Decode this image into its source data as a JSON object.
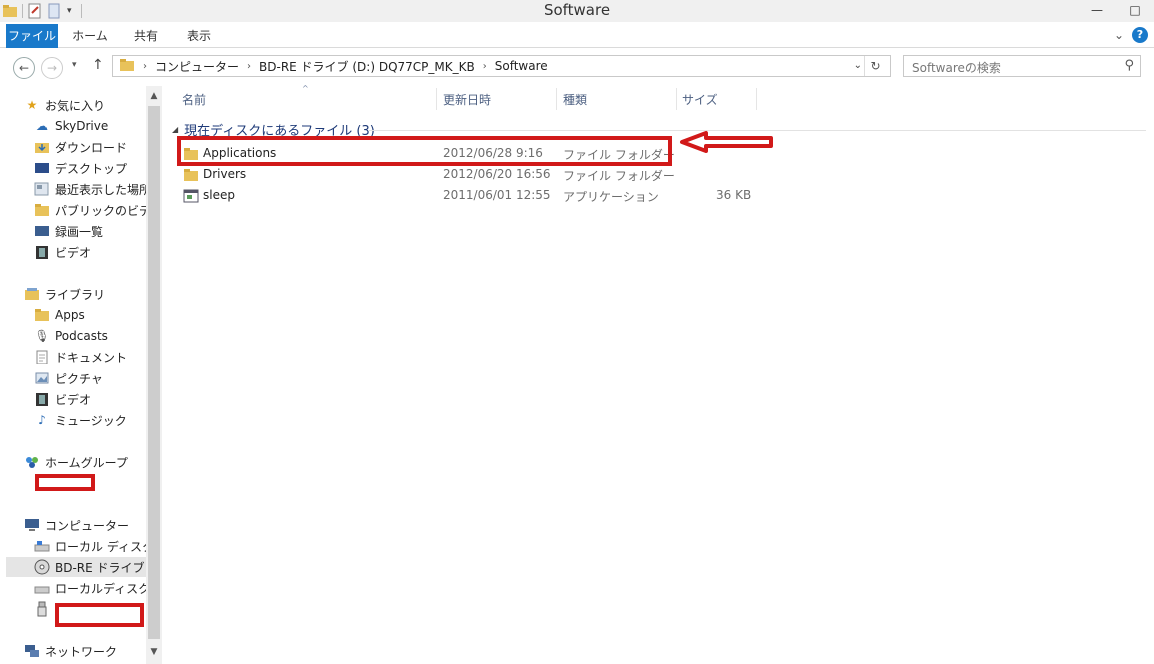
{
  "window": {
    "title": "Software",
    "minimize": "—",
    "maximize": "□"
  },
  "ribbon": {
    "tabs": [
      "ファイル",
      "ホーム",
      "共有",
      "表示"
    ]
  },
  "address": {
    "crumbs": [
      "コンピューター",
      "BD-RE ドライブ (D:) DQ77CP_MK_KB",
      "Software"
    ]
  },
  "search": {
    "placeholder": "Softwareの検索"
  },
  "navpane": {
    "favorites": {
      "label": "お気に入り",
      "items": [
        "SkyDrive",
        "ダウンロード",
        "デスクトップ",
        "最近表示した場所",
        "パブリックのビデオ",
        "録画一覧",
        "ビデオ"
      ]
    },
    "libraries": {
      "label": "ライブラリ",
      "items": [
        "Apps",
        "Podcasts",
        "ドキュメント",
        "ピクチャ",
        "ビデオ",
        "ミュージック"
      ]
    },
    "homegroup": {
      "label": "ホームグループ"
    },
    "computer": {
      "label": "コンピューター",
      "items": [
        "ローカル ディスク (C",
        "BD-RE ドライブ (D",
        "ローカルディスク (E"
      ]
    },
    "network": {
      "label": "ネットワーク"
    }
  },
  "columns": {
    "name": "名前",
    "date": "更新日時",
    "type": "種類",
    "size": "サイズ"
  },
  "group": {
    "label": "現在ディスクにあるファイル (3)"
  },
  "files": [
    {
      "name": "Applications",
      "date": "2012/06/28 9:16",
      "type": "ファイル フォルダー",
      "size": ""
    },
    {
      "name": "Drivers",
      "date": "2012/06/20 16:56",
      "type": "ファイル フォルダー",
      "size": ""
    },
    {
      "name": "sleep",
      "date": "2011/06/01 12:55",
      "type": "アプリケーション",
      "size": "36 KB"
    }
  ],
  "colors": {
    "file_tab": "#1979ca",
    "annotation_red": "#d11919",
    "folder_yellow": "#e8c25a"
  }
}
